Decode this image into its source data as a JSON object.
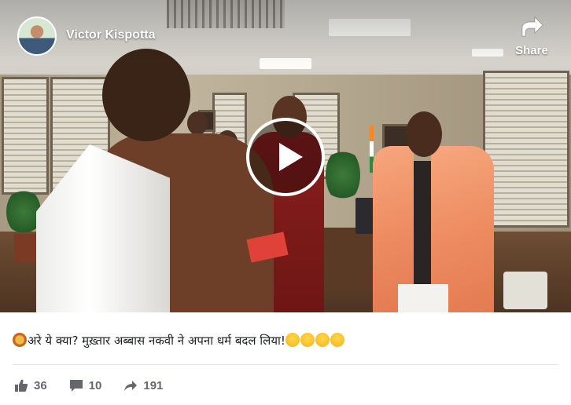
{
  "post": {
    "author": "Victor Kispotta",
    "share_label": "Share",
    "caption_text": "अरे ये क्या? मुख़्तार अब्बास नकवी ने अपना धर्म बदल लिया!",
    "caption_leading_emoji": "lion-face-emoji",
    "caption_trailing_emojis": [
      "winking-tongue-emoji",
      "astonished-emoji",
      "laughing-tears-emoji",
      "astonished-emoji"
    ]
  },
  "video": {
    "play_icon": "play-icon"
  },
  "stats": {
    "likes": "36",
    "comments": "10",
    "shares": "191",
    "like_icon": "thumbs-up-icon",
    "comment_icon": "comment-icon",
    "share_icon": "share-arrow-icon"
  },
  "colors": {
    "text_primary": "#1c1e21",
    "text_secondary": "#65676b",
    "overlay_text": "#ffffff"
  }
}
